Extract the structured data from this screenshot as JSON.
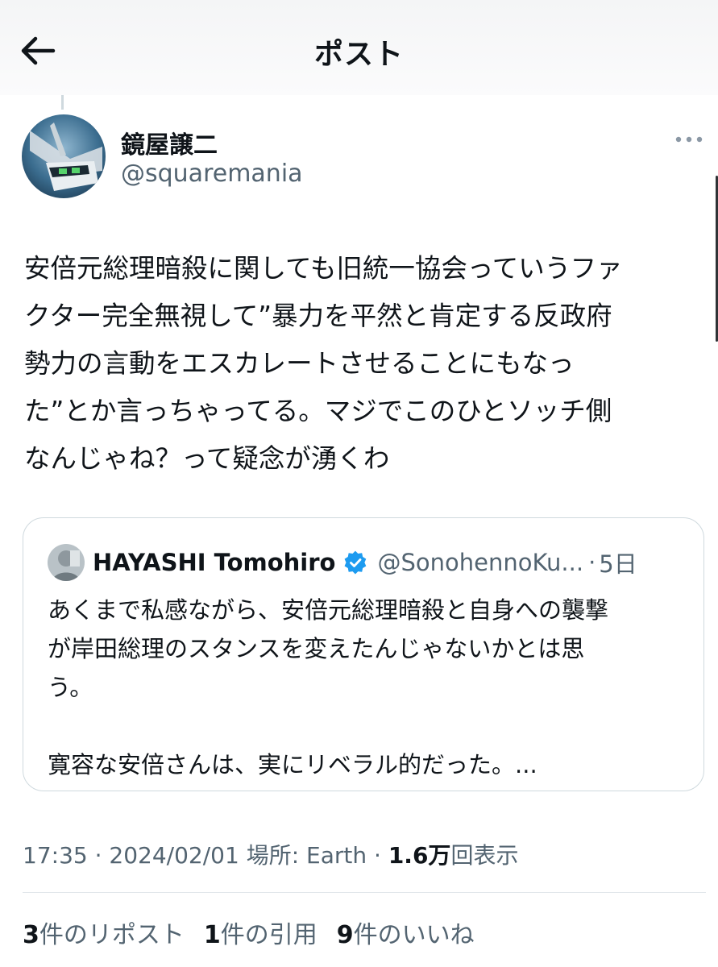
{
  "header": {
    "title": "ポスト",
    "back_icon": "arrow-left-icon"
  },
  "author": {
    "display_name": "鏡屋譲二",
    "handle": "@squaremania",
    "more_icon": "more-horizontal-icon"
  },
  "post": {
    "text": "安倍元総理暗殺に関しても旧統一協会っていうファ\nクター完全無視して”暴力を平然と肯定する反政府\n勢力の言動をエスカレートさせることにもなっ\nた”とか言っちゃってる。マジでこのひとソッチ側\nなんじゃね？って疑念が湧くわ"
  },
  "quoted_post": {
    "display_name": "HAYASHI Tomohiro",
    "verified_icon": "verified-badge-icon",
    "handle": "@SonohennoKu...",
    "separator": "·",
    "time": "5日",
    "text": "あくまで私感ながら、安倍元総理暗殺と自身への襲撃\nが岸田総理のスタンスを変えたんじゃないかとは思\nう。\n\n寛容な安倍さんは、実にリベラル的だった。..."
  },
  "meta": {
    "time": "17:35",
    "sep1": " · ",
    "date": "2024/02/01",
    "location": " 場所: Earth",
    "sep2": " · ",
    "views_count": "1.6万",
    "views_label": "回表示"
  },
  "stats": [
    {
      "count": "3",
      "label": "件のリポスト"
    },
    {
      "count": "1",
      "label": "件の引用"
    },
    {
      "count": "9",
      "label": "件のいいね"
    }
  ],
  "colors": {
    "text": "#0f1419",
    "secondary": "#536471",
    "verified": "#1d9bf0",
    "border": "#cfd9de"
  }
}
